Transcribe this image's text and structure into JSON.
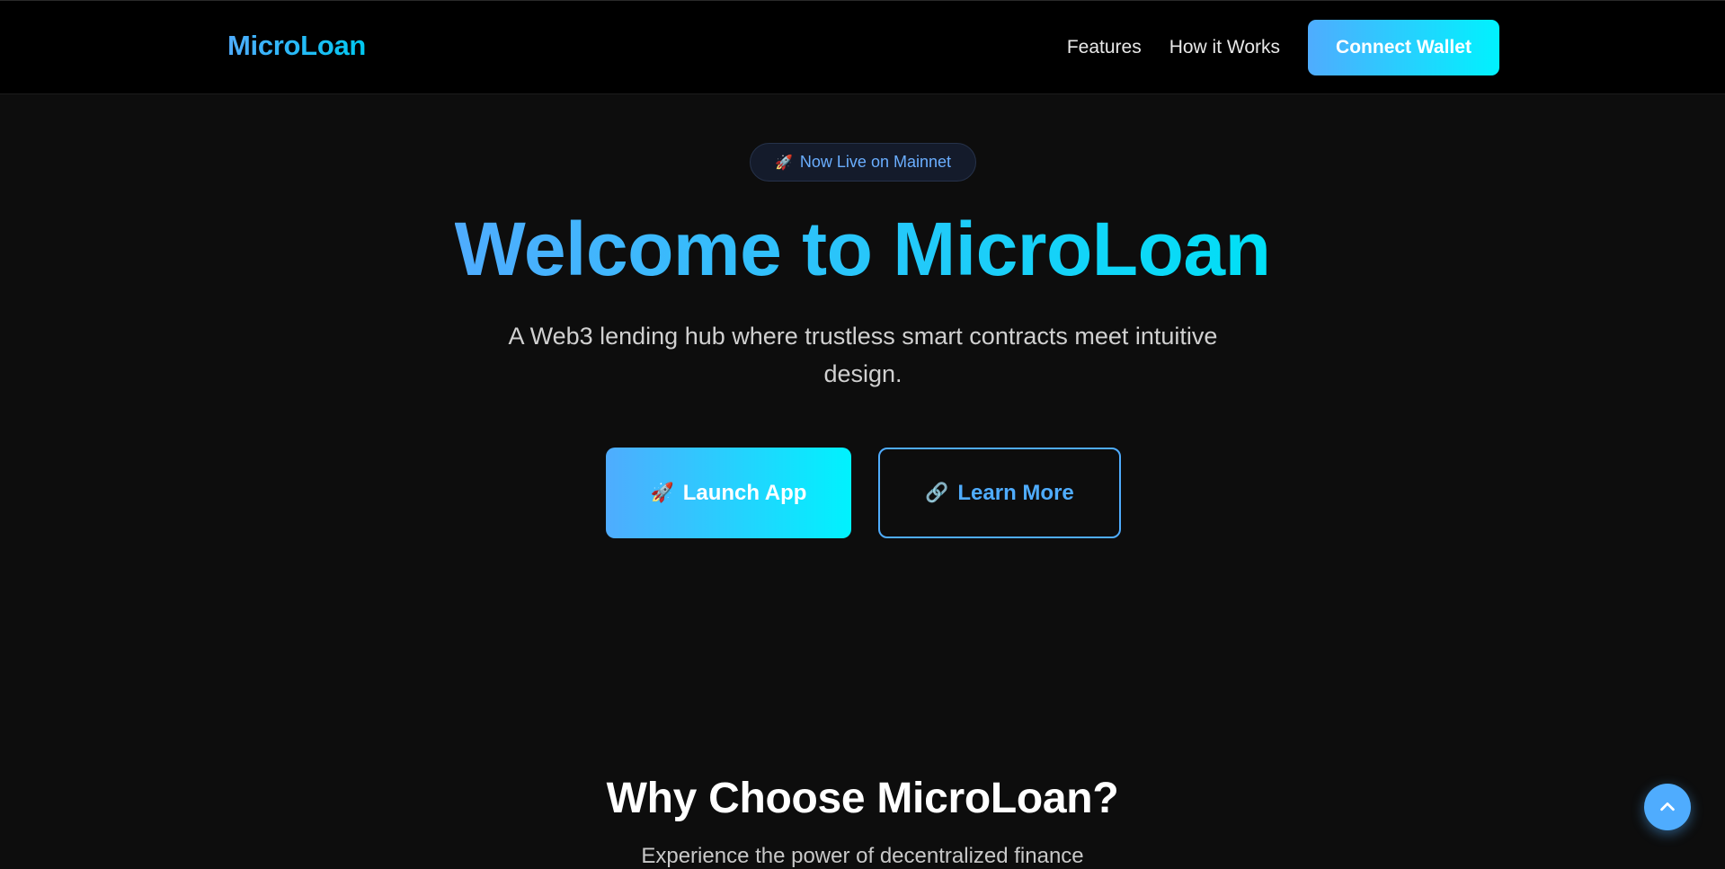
{
  "nav": {
    "brand": "MicroLoan",
    "links": [
      "Features",
      "How it Works"
    ],
    "connect_label": "Connect Wallet"
  },
  "hero": {
    "badge_icon": "rocket-icon",
    "badge_emoji": "🚀",
    "badge_text": "Now Live on Mainnet",
    "title": "Welcome to MicroLoan",
    "subtitle": "A Web3 lending hub where trustless smart contracts meet intuitive design.",
    "primary_icon": "rocket-icon",
    "primary_emoji": "🚀",
    "primary_label": "Launch App",
    "secondary_icon": "link-icon",
    "secondary_emoji": "🔗",
    "secondary_label": "Learn More"
  },
  "features": {
    "title": "Why Choose MicroLoan?",
    "subtitle": "Experience the power of decentralized finance"
  },
  "scroll_top": {
    "icon": "chevron-up-icon"
  },
  "colors": {
    "accent_start": "#4facfe",
    "accent_end": "#00f2fe",
    "background": "#0d0d0d",
    "nav_background": "#000000"
  }
}
